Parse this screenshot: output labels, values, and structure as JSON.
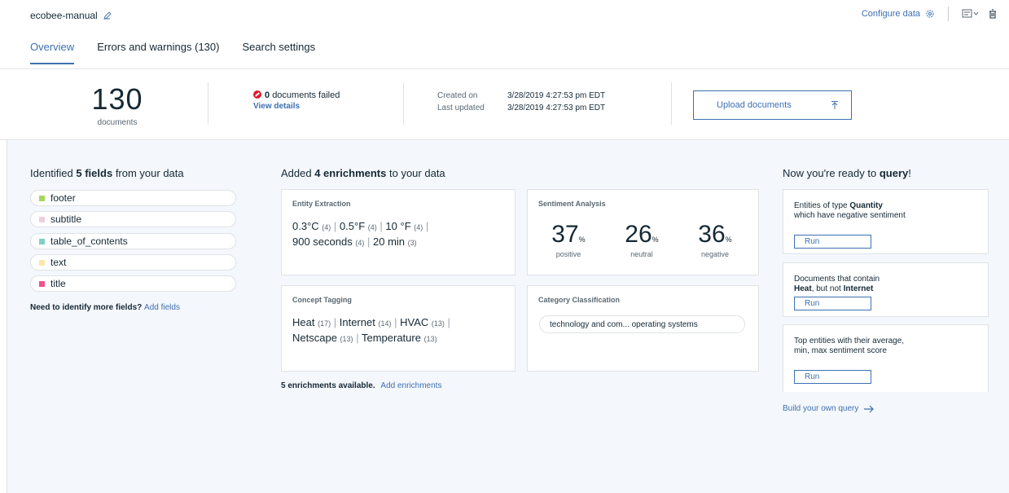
{
  "header": {
    "title": "ecobee-manual",
    "configure_label": "Configure data"
  },
  "tabs": [
    {
      "label": "Overview"
    },
    {
      "label": "Errors and warnings (130)"
    },
    {
      "label": "Search settings"
    }
  ],
  "summary": {
    "doc_count": "130",
    "doc_label": "documents",
    "failed_count": "0",
    "failed_label": "documents failed",
    "view_details": "View details",
    "created_label": "Created on",
    "created_value": "3/28/2019 4:27:53 pm EDT",
    "updated_label": "Last updated",
    "updated_value": "3/28/2019 4:27:53 pm EDT",
    "upload_label": "Upload documents"
  },
  "fields": {
    "heading_pre": "Identified",
    "heading_bold": "5 fields",
    "heading_post": "from your data",
    "items": [
      {
        "label": "footer",
        "color": "#a6d85c"
      },
      {
        "label": "subtitle",
        "color": "#f2cdd9"
      },
      {
        "label": "table_of_contents",
        "color": "#7fd1c2"
      },
      {
        "label": "text",
        "color": "#fbe7a7"
      },
      {
        "label": "title",
        "color": "#ee538b"
      }
    ],
    "need_text": "Need to identify more fields?",
    "add_fields": "Add fields"
  },
  "enrichments": {
    "heading_pre": "Added",
    "heading_bold": "4 enrichments",
    "heading_post": "to your data",
    "entity": {
      "title": "Entity Extraction",
      "items": [
        {
          "v": "0.3°C",
          "c": "(4)"
        },
        {
          "v": "0.5°F",
          "c": "(4)"
        },
        {
          "v": "10 °F",
          "c": "(4)"
        },
        {
          "v": "900 seconds",
          "c": "(4)"
        },
        {
          "v": "20 min",
          "c": "(3)"
        }
      ]
    },
    "sentiment": {
      "title": "Sentiment Analysis",
      "positive": "37",
      "positive_label": "positive",
      "neutral": "26",
      "neutral_label": "neutral",
      "negative": "36",
      "negative_label": "negative",
      "unit": "%"
    },
    "concept": {
      "title": "Concept Tagging",
      "items": [
        {
          "v": "Heat",
          "c": "(17)"
        },
        {
          "v": "Internet",
          "c": "(14)"
        },
        {
          "v": "HVAC",
          "c": "(13)"
        },
        {
          "v": "Netscape",
          "c": "(13)"
        },
        {
          "v": "Temperature",
          "c": "(13)"
        }
      ]
    },
    "category": {
      "title": "Category Classification",
      "pill": "technology and com... operating systems"
    },
    "footer_bold": "5 enrichments available.",
    "footer_link": "Add enrichments"
  },
  "query": {
    "heading_pre": "Now you're ready to",
    "heading_bold": "query",
    "heading_post": "!",
    "run_label": "Run",
    "q1_pre": "Entities of type",
    "q1_bold": "Quantity",
    "q1_post": "which have negative sentiment",
    "q2_pre": "Documents that contain",
    "q2_bold1": "Heat",
    "q2_mid": ", but not",
    "q2_bold2": "Internet",
    "q3": "Top entities with their average, min, max sentiment score",
    "build_label": "Build your own query"
  }
}
